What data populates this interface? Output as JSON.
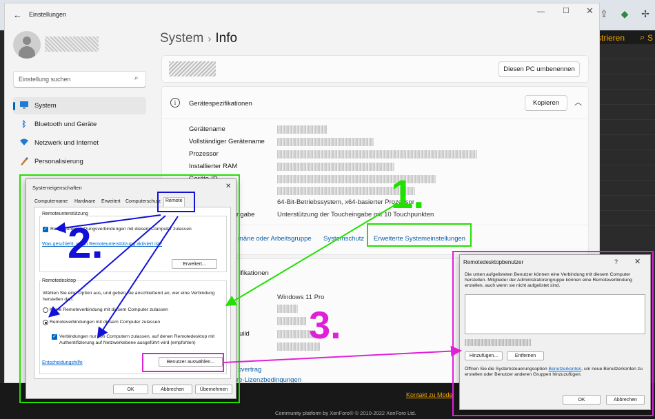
{
  "browser": {
    "icons": [
      "info-icon",
      "download-icon",
      "share-icon",
      "shield-extension-icon",
      "puzzle-icon"
    ],
    "site": {
      "register_label": "strieren",
      "search_label": "S",
      "footer_link": "Kontakt zu Mode",
      "footer_credit": "Community platform by XenForo® © 2010-2022 XenForo Ltd."
    }
  },
  "settings": {
    "window_title": "Einstellungen",
    "search_placeholder": "Einstellung suchen",
    "nav": [
      {
        "label": "System",
        "icon": "monitor-icon",
        "active": true
      },
      {
        "label": "Bluetooth und Geräte",
        "icon": "bluetooth-icon",
        "active": false
      },
      {
        "label": "Netzwerk und Internet",
        "icon": "wifi-icon",
        "active": false
      },
      {
        "label": "Personalisierung",
        "icon": "brush-icon",
        "active": false
      }
    ],
    "breadcrumb": {
      "parent": "System",
      "separator": "›",
      "current": "Info"
    },
    "rename_button": "Diesen PC umbenennen",
    "device_specs": {
      "title": "Gerätespezifikationen",
      "copy_button": "Kopieren",
      "labels": [
        "Gerätename",
        "Vollständiger Gerätename",
        "Prozessor",
        "Installierter RAM",
        "Geräte-ID"
      ],
      "visible_values": [
        {
          "label": "",
          "value": "64-Bit-Betriebssystem, x64-basierter Prozessor"
        },
        {
          "label": "ngabe",
          "value": "Unterstützung der Toucheingabe mit 10 Touchpunkten"
        }
      ]
    },
    "related_links": [
      "mäne oder Arbeitsgruppe",
      "Systemschutz",
      "Erweiterte Systemeinstellungen"
    ],
    "windows_specs": {
      "title_fragment": "ifikationen",
      "edition": "Windows 11 Pro",
      "build_fragment": "uild",
      "link_contract": "xvertrag",
      "link_license": "re-Lizenzbedingungen"
    }
  },
  "system_properties": {
    "title": "Systemeigenschaften",
    "tabs": [
      "Computername",
      "Hardware",
      "Erweitert",
      "Computerschutz",
      "Remote"
    ],
    "active_tab": "Remote",
    "remote_assistance": {
      "group_title": "Remoteunterstützung",
      "checkbox_label": "Remoteunterstützungsverbindungen mit diesem Computer zulassen",
      "checked": true,
      "help_link": "Was geschieht, wenn Remoteunterstützung aktiviert ist?",
      "advanced_button": "Erweitert..."
    },
    "remote_desktop": {
      "group_title": "Remotedesktop",
      "instruction": "Wählen Sie eine Option aus, und geben Sie anschließend an, wer eine Verbindung herstellen darf.",
      "options": [
        {
          "label": "Keine Remoteverbindung mit diesem Computer zulassen",
          "selected": false
        },
        {
          "label": "Remoteverbindungen mit diesem Computer zulassen",
          "selected": true
        }
      ],
      "nla_checkbox": "Verbindungen nur von Computern zulassen, auf denen Remotedesktop mit Authentifizierung auf Netzwerkebene ausgeführt wird (empfohlen)",
      "nla_checked": true,
      "help_link": "Entscheidungshilfe",
      "select_users_button": "Benutzer auswählen..."
    },
    "buttons": {
      "ok": "OK",
      "cancel": "Abbrechen",
      "apply": "Übernehmen"
    }
  },
  "remote_desktop_users": {
    "title": "Remotedesktopbenutzer",
    "help_glyph": "?",
    "description": "Die unten aufgelisteten Benutzer können eine Verbindung mit diesem Computer herstellen. Mitglieder der Administratorengruppe können eine Remoteverbindung erstellen, auch wenn sie nicht aufgelistet sind.",
    "add_button": "Hinzufügen...",
    "remove_button": "Entfernen",
    "footer_before": "Öffnen Sie die Systemsteuerungsoption ",
    "footer_link": "Benutzerkonten",
    "footer_after": ", um neue Benutzerkonten zu erstellen oder Benutzer anderen Gruppen hinzuzufügen.",
    "ok_button": "OK",
    "cancel_button": "Abbrechen"
  },
  "annotations": {
    "steps": [
      "1.",
      "2.",
      "3."
    ],
    "colors": {
      "green": "#22e000",
      "blue": "#1010d8",
      "magenta": "#e020d8"
    }
  },
  "theme": {
    "accent": "#005fb8",
    "link": "#0a5ea8",
    "site_accent": "#f0a400"
  }
}
